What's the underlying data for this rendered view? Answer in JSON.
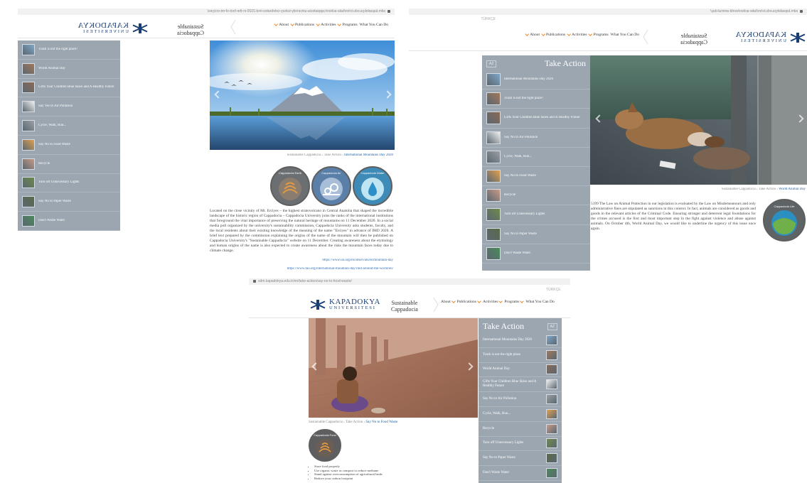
{
  "site": {
    "logo_big": "KAPADOKYA",
    "logo_small": "UNIVERSITESI",
    "title_line1": "Sustainable",
    "title_line2": "Cappadocia",
    "language": "TÜRKÇE",
    "nav": [
      {
        "label": "About"
      },
      {
        "label": "Publications"
      },
      {
        "label": "Activities"
      },
      {
        "label": "Programs"
      },
      {
        "label": "What You Can Do"
      }
    ]
  },
  "panels": {
    "mountain": {
      "url": "sdm.kapadokya.edu.tr/en/take-action/cappadocia-university-turkey-celebrates-imd-2020-in-the-foot-of-mt-erciyes/",
      "sidebar": [
        "Trash is not the right place!",
        "World Animal Day",
        "Gifts Your Children Blue Skies and A Healthy Future",
        "Say Yes to Air Pollution",
        "Cycle, Walk, Run...",
        "Say No to Food Waste",
        "Recycle",
        "Turn off Unnecessary Lights",
        "Say No to Paper Waste",
        "Don't Waste Water"
      ],
      "breadcrumb_prefix": "Sustainable Cappadocia › Take Action ›",
      "breadcrumb_current": "International Mountains Day 2020",
      "badges": [
        "Cappadocia Water",
        "Cappadocia Air",
        "Cappadocia Earth"
      ],
      "body": "Located on the close vicinity of Mt. Erciyes – the highest stratovolcano in Central Anatolia that shaped the incredible landscape of the historic region of Cappadocia – Cappadocia University joins the ranks of the international institutions that foreground the vital importance of preserving the natural heritage of mountains on 11 December 2020. In a social media poll organized by the university's sustainability commission, Cappadocia University asks students, faculty, and the local residents about their existing knowledge of the meaning of the name \"Erciyes\" in advance of IMD 2020. A brief text prepared by the commission explaining the origins of the name of the mountain will then be published on Cappadocia University's \"Sustainable Cappadocia\" website on 11 December. Creating awareness about the etymology and human origins of the name is also expected to create awareness about the risks the mountain faces today due to climate change.",
      "links": [
        "https://www.un.org/en/observances/mountain-day",
        "https://www.fao.org/international-mountain-day/imd-around-the-world/en/"
      ]
    },
    "animal": {
      "url": "sdm.kapadokya.edu.tr/en/take-action/world-animal-day/",
      "language": "TÜRKÇE",
      "sidebar_title": "Take Action",
      "az": "AZ",
      "sidebar": [
        "International Mountains Day 2020",
        "Trash is not the right place!",
        "Gifts Your Children Blue Skies and A Healthy Future",
        "Say No to Air Pollution",
        "Cycle, Walk, Run...",
        "Say No to Food Waste",
        "Recycle",
        "Turn off Unnecessary Lights",
        "Say No to Paper Waste",
        "Don't Waste Water"
      ],
      "breadcrumb_prefix": "Sustainable Cappadocia › Take Action ›",
      "breadcrumb_current": "World Animal Day",
      "badge": "Cappadocia Life",
      "body": "5199 The Law on Animal Protection in our legislation is evaluated by the Law on Misdemeanours and only administrative fines are stipulated as sanctions in this context. In fact, animals are considered as goods and goods in the relevant articles of the Criminal Code. Ensuring stronger and deterrent legal foundations for the crimes accused is the first and most important step in the fight against violence and abuse against animals. On October 4th, World Animal Day, we would like to underline the urgency of this issue once again."
    },
    "food": {
      "url": "sdm.kapadokya.edu.tr/en/take-action/say-no-to-food-waste/",
      "language": "TÜRKÇE",
      "sidebar_title": "Take Action",
      "az": "AZ",
      "sidebar": [
        "International Mountains Day 2020",
        "Trash is not the right place",
        "World Animal Day",
        "Gifts Your Children Blue Skies and A Healthy Future",
        "Say No to Air Pollution",
        "Cycle, Walk, Run...",
        "Recycle",
        "Turn off Unnecessary Lights",
        "Say No to Paper Waste",
        "Don't Waste Water"
      ],
      "breadcrumb_prefix": "Sustainable Cappadocia › Take Action ›",
      "breadcrumb_current": "Say No to Food Waste",
      "badge": "Cappadocia Food",
      "bullets": [
        "Store food properly",
        "Use organic waste as compost to reduce methane",
        "Stand against overconsumption of agricultural lands",
        "Reduce your carbon footprint"
      ]
    }
  }
}
